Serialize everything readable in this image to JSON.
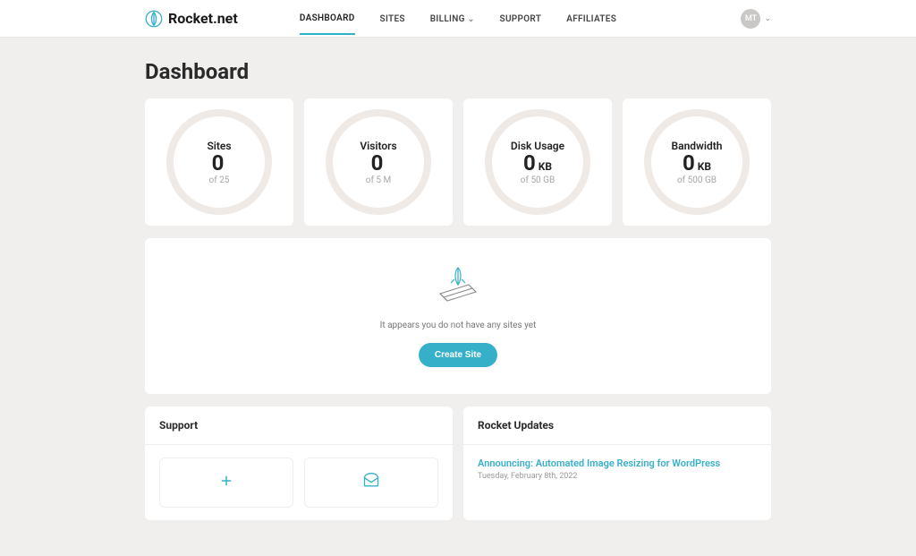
{
  "brand": {
    "name": "Rocket.net"
  },
  "nav": {
    "dashboard": "DASHBOARD",
    "sites": "SITES",
    "billing": "BILLING",
    "support": "SUPPORT",
    "affiliates": "AFFILIATES"
  },
  "avatar": {
    "initials": "MT"
  },
  "page": {
    "title": "Dashboard"
  },
  "stats": {
    "sites": {
      "title": "Sites",
      "value": "0",
      "unit": "",
      "sub": "of 25"
    },
    "visitors": {
      "title": "Visitors",
      "value": "0",
      "unit": "",
      "sub": "of 5 M"
    },
    "disk": {
      "title": "Disk Usage",
      "value": "0",
      "unit": "KB",
      "sub": "of 50 GB"
    },
    "bandwidth": {
      "title": "Bandwidth",
      "value": "0",
      "unit": "KB",
      "sub": "of 500 GB"
    }
  },
  "empty": {
    "message": "It appears you do not have any sites yet",
    "cta": "Create Site"
  },
  "panels": {
    "support_title": "Support",
    "updates_title": "Rocket Updates"
  },
  "updates": [
    {
      "title": "Announcing: Automated Image Resizing for WordPress",
      "date": "Tuesday, February 8th, 2022"
    }
  ]
}
